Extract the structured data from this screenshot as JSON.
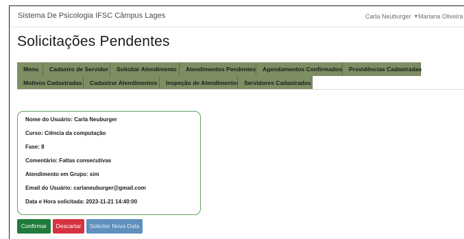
{
  "app": {
    "brand": "Sistema De Psicologia IFSC Câmpus Lages"
  },
  "navbar": {
    "user_menus": [
      {
        "label": "Carla Neuburger"
      },
      {
        "label": "Mariana Oliveira"
      }
    ]
  },
  "page": {
    "title": "Solicitações Pendentes"
  },
  "tabs": {
    "row1": [
      {
        "label": "Menu"
      },
      {
        "label": "Cadastro de Servidor"
      },
      {
        "label": "Solicitar Atendimento"
      },
      {
        "label": "Atendimentos Pendentes"
      },
      {
        "label": "Agendamentos Confirmados"
      },
      {
        "label": "Providências Cadastradas"
      }
    ],
    "row2": [
      {
        "label": "Motivos Cadastradas"
      },
      {
        "label": "Cadastrar Atendimentos"
      },
      {
        "label": "Inspeção de Atendimentos"
      },
      {
        "label": "Servidores Cadastrados"
      }
    ],
    "color": "#7e8e63"
  },
  "request": {
    "user_name": "Nome do Usuário: Carla Neuburger",
    "course": "Curso: Ciência da computação",
    "phase": "Fase: 8",
    "comment": "Comentário: Faltas consecutivas",
    "group": "Atendimento em Grupo: sim",
    "email": "Email do Usuário: carlaneuburger@gmail.com",
    "datetime": "Data e Hora solicitada: 2023-11-21 14:40:00",
    "border_color": "#5aa35a"
  },
  "actions": {
    "confirm": "Confirmar",
    "discard": "Descartar",
    "new_date": "Solicitar Nova Data",
    "colors": {
      "confirm": "#1f7a3b",
      "discard": "#d6323f",
      "new_date": "#5e8fbd"
    }
  }
}
